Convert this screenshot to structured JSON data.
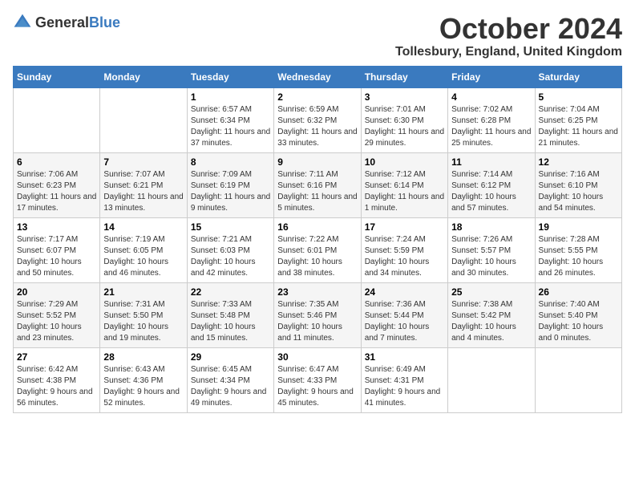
{
  "header": {
    "logo_general": "General",
    "logo_blue": "Blue",
    "month": "October 2024",
    "location": "Tollesbury, England, United Kingdom"
  },
  "days_of_week": [
    "Sunday",
    "Monday",
    "Tuesday",
    "Wednesday",
    "Thursday",
    "Friday",
    "Saturday"
  ],
  "weeks": [
    [
      {
        "day": "",
        "info": ""
      },
      {
        "day": "",
        "info": ""
      },
      {
        "day": "1",
        "info": "Sunrise: 6:57 AM\nSunset: 6:34 PM\nDaylight: 11 hours and 37 minutes."
      },
      {
        "day": "2",
        "info": "Sunrise: 6:59 AM\nSunset: 6:32 PM\nDaylight: 11 hours and 33 minutes."
      },
      {
        "day": "3",
        "info": "Sunrise: 7:01 AM\nSunset: 6:30 PM\nDaylight: 11 hours and 29 minutes."
      },
      {
        "day": "4",
        "info": "Sunrise: 7:02 AM\nSunset: 6:28 PM\nDaylight: 11 hours and 25 minutes."
      },
      {
        "day": "5",
        "info": "Sunrise: 7:04 AM\nSunset: 6:25 PM\nDaylight: 11 hours and 21 minutes."
      }
    ],
    [
      {
        "day": "6",
        "info": "Sunrise: 7:06 AM\nSunset: 6:23 PM\nDaylight: 11 hours and 17 minutes."
      },
      {
        "day": "7",
        "info": "Sunrise: 7:07 AM\nSunset: 6:21 PM\nDaylight: 11 hours and 13 minutes."
      },
      {
        "day": "8",
        "info": "Sunrise: 7:09 AM\nSunset: 6:19 PM\nDaylight: 11 hours and 9 minutes."
      },
      {
        "day": "9",
        "info": "Sunrise: 7:11 AM\nSunset: 6:16 PM\nDaylight: 11 hours and 5 minutes."
      },
      {
        "day": "10",
        "info": "Sunrise: 7:12 AM\nSunset: 6:14 PM\nDaylight: 11 hours and 1 minute."
      },
      {
        "day": "11",
        "info": "Sunrise: 7:14 AM\nSunset: 6:12 PM\nDaylight: 10 hours and 57 minutes."
      },
      {
        "day": "12",
        "info": "Sunrise: 7:16 AM\nSunset: 6:10 PM\nDaylight: 10 hours and 54 minutes."
      }
    ],
    [
      {
        "day": "13",
        "info": "Sunrise: 7:17 AM\nSunset: 6:07 PM\nDaylight: 10 hours and 50 minutes."
      },
      {
        "day": "14",
        "info": "Sunrise: 7:19 AM\nSunset: 6:05 PM\nDaylight: 10 hours and 46 minutes."
      },
      {
        "day": "15",
        "info": "Sunrise: 7:21 AM\nSunset: 6:03 PM\nDaylight: 10 hours and 42 minutes."
      },
      {
        "day": "16",
        "info": "Sunrise: 7:22 AM\nSunset: 6:01 PM\nDaylight: 10 hours and 38 minutes."
      },
      {
        "day": "17",
        "info": "Sunrise: 7:24 AM\nSunset: 5:59 PM\nDaylight: 10 hours and 34 minutes."
      },
      {
        "day": "18",
        "info": "Sunrise: 7:26 AM\nSunset: 5:57 PM\nDaylight: 10 hours and 30 minutes."
      },
      {
        "day": "19",
        "info": "Sunrise: 7:28 AM\nSunset: 5:55 PM\nDaylight: 10 hours and 26 minutes."
      }
    ],
    [
      {
        "day": "20",
        "info": "Sunrise: 7:29 AM\nSunset: 5:52 PM\nDaylight: 10 hours and 23 minutes."
      },
      {
        "day": "21",
        "info": "Sunrise: 7:31 AM\nSunset: 5:50 PM\nDaylight: 10 hours and 19 minutes."
      },
      {
        "day": "22",
        "info": "Sunrise: 7:33 AM\nSunset: 5:48 PM\nDaylight: 10 hours and 15 minutes."
      },
      {
        "day": "23",
        "info": "Sunrise: 7:35 AM\nSunset: 5:46 PM\nDaylight: 10 hours and 11 minutes."
      },
      {
        "day": "24",
        "info": "Sunrise: 7:36 AM\nSunset: 5:44 PM\nDaylight: 10 hours and 7 minutes."
      },
      {
        "day": "25",
        "info": "Sunrise: 7:38 AM\nSunset: 5:42 PM\nDaylight: 10 hours and 4 minutes."
      },
      {
        "day": "26",
        "info": "Sunrise: 7:40 AM\nSunset: 5:40 PM\nDaylight: 10 hours and 0 minutes."
      }
    ],
    [
      {
        "day": "27",
        "info": "Sunrise: 6:42 AM\nSunset: 4:38 PM\nDaylight: 9 hours and 56 minutes."
      },
      {
        "day": "28",
        "info": "Sunrise: 6:43 AM\nSunset: 4:36 PM\nDaylight: 9 hours and 52 minutes."
      },
      {
        "day": "29",
        "info": "Sunrise: 6:45 AM\nSunset: 4:34 PM\nDaylight: 9 hours and 49 minutes."
      },
      {
        "day": "30",
        "info": "Sunrise: 6:47 AM\nSunset: 4:33 PM\nDaylight: 9 hours and 45 minutes."
      },
      {
        "day": "31",
        "info": "Sunrise: 6:49 AM\nSunset: 4:31 PM\nDaylight: 9 hours and 41 minutes."
      },
      {
        "day": "",
        "info": ""
      },
      {
        "day": "",
        "info": ""
      }
    ]
  ]
}
